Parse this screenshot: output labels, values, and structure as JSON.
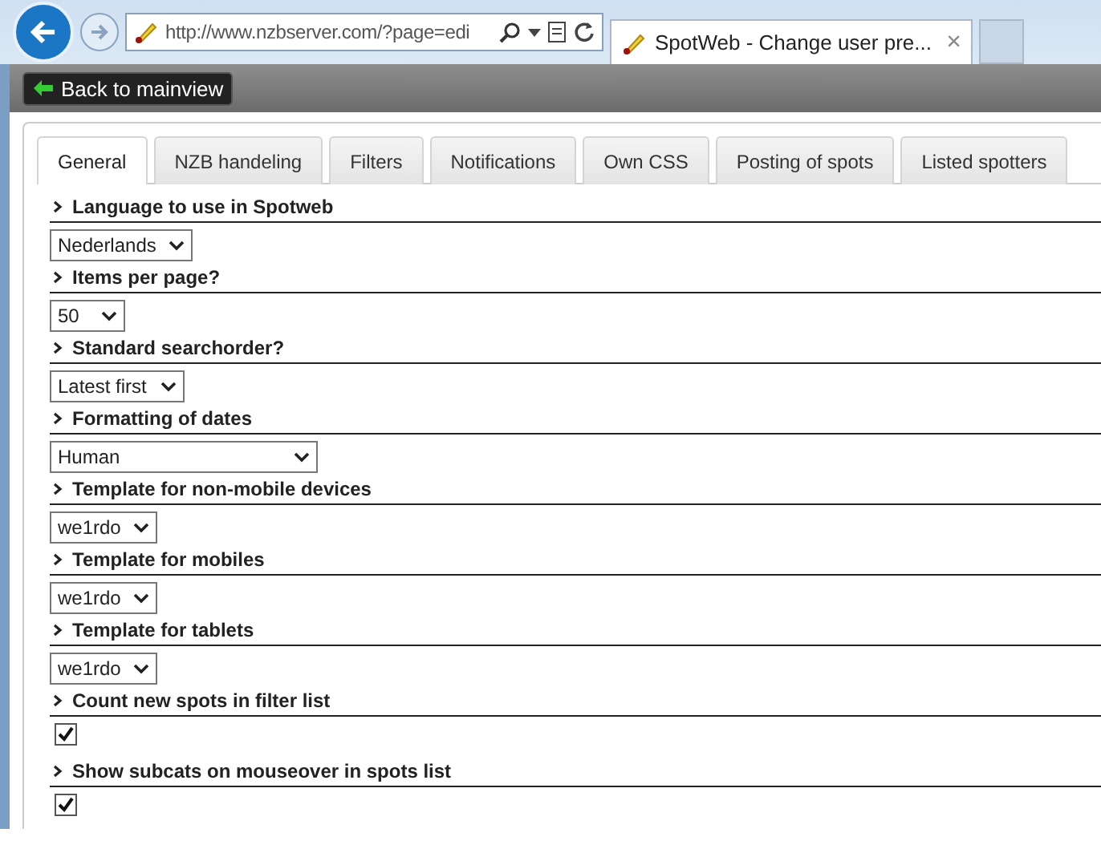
{
  "browser": {
    "address": "http://www.nzbserver.com/?page=edi",
    "tab_title": "SpotWeb - Change user pre...",
    "tab_close": "×"
  },
  "toolbar": {
    "back_button": "Back to mainview"
  },
  "tabs": [
    {
      "label": "General",
      "selected": true
    },
    {
      "label": "NZB handeling",
      "selected": false
    },
    {
      "label": "Filters",
      "selected": false
    },
    {
      "label": "Notifications",
      "selected": false
    },
    {
      "label": "Own CSS",
      "selected": false
    },
    {
      "label": "Posting of spots",
      "selected": false
    },
    {
      "label": "Listed spotters",
      "selected": false
    }
  ],
  "settings": [
    {
      "kind": "select",
      "label": "Language to use in Spotweb",
      "value": "Nederlands"
    },
    {
      "kind": "select",
      "label": "Items per page?",
      "value": "50"
    },
    {
      "kind": "select",
      "label": "Standard searchorder?",
      "value": "Latest first"
    },
    {
      "kind": "select",
      "label": "Formatting of dates",
      "value": "Human"
    },
    {
      "kind": "select",
      "label": "Template for non-mobile devices",
      "value": "we1rdo"
    },
    {
      "kind": "select",
      "label": "Template for mobiles",
      "value": "we1rdo"
    },
    {
      "kind": "select",
      "label": "Template for tablets",
      "value": "we1rdo"
    },
    {
      "kind": "checkbox",
      "label": "Count new spots in filter list",
      "checked": true
    },
    {
      "kind": "checkbox",
      "label": "Show subcats on mouseover in spots list",
      "checked": true
    }
  ]
}
